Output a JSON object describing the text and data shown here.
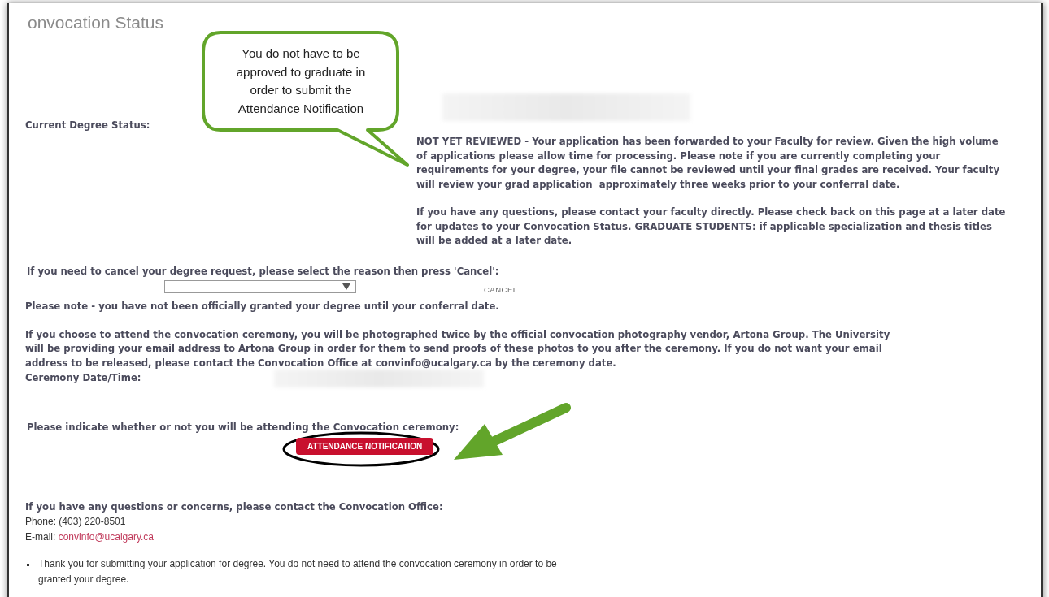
{
  "page": {
    "title": "onvocation Status"
  },
  "degree_status": {
    "label": "Current Degree Status:",
    "paragraphs": [
      "NOT YET REVIEWED - Your application has been forwarded to your Faculty for review. Given the high volume of applications please allow time for processing. Please note if you are currently completing your requirements for your degree, your file cannot be reviewed until your final grades are received. Your faculty will review your grad application  approximately three weeks prior to your conferral date.",
      "If you have any questions, please contact your faculty directly. Please check back on this page at a later date for updates to your Convocation Status. GRADUATE STUDENTS: if applicable specialization and thesis titles will be added at a later date."
    ]
  },
  "cancel": {
    "prompt": "If you need to cancel your degree request, please select the reason then press 'Cancel':",
    "button": "CANCEL"
  },
  "note": "Please note - you have not been officially granted your degree until your conferral date.",
  "photo_notice": "If you choose to attend the convocation ceremony, you will be photographed twice by the official convocation photography vendor, Artona Group. The University will be providing your email address to Artona Group in order for them to send proofs of these photos to you after the ceremony. If you do not want your email address to be released, please contact the Convocation Office at convinfo@ucalgary.ca by the ceremony date.",
  "ceremony": {
    "label": "Ceremony Date/Time:"
  },
  "attendance": {
    "prompt": "Please indicate whether or not you will be attending the Convocation ceremony:",
    "button": "ATTENDANCE NOTIFICATION"
  },
  "contact": {
    "heading": "If you have any questions or concerns, please contact the Convocation Office:",
    "phone": "Phone: (403) 220-8501",
    "email_label": "E-mail:",
    "email": "convinfo@ucalgary.ca"
  },
  "bullets": [
    "Thank you for submitting your application for degree. You do not need to attend the convocation ceremony in order to be granted your degree."
  ],
  "callout": {
    "text": "You do not have to be approved to graduate in order to submit the Attendance Notification"
  }
}
